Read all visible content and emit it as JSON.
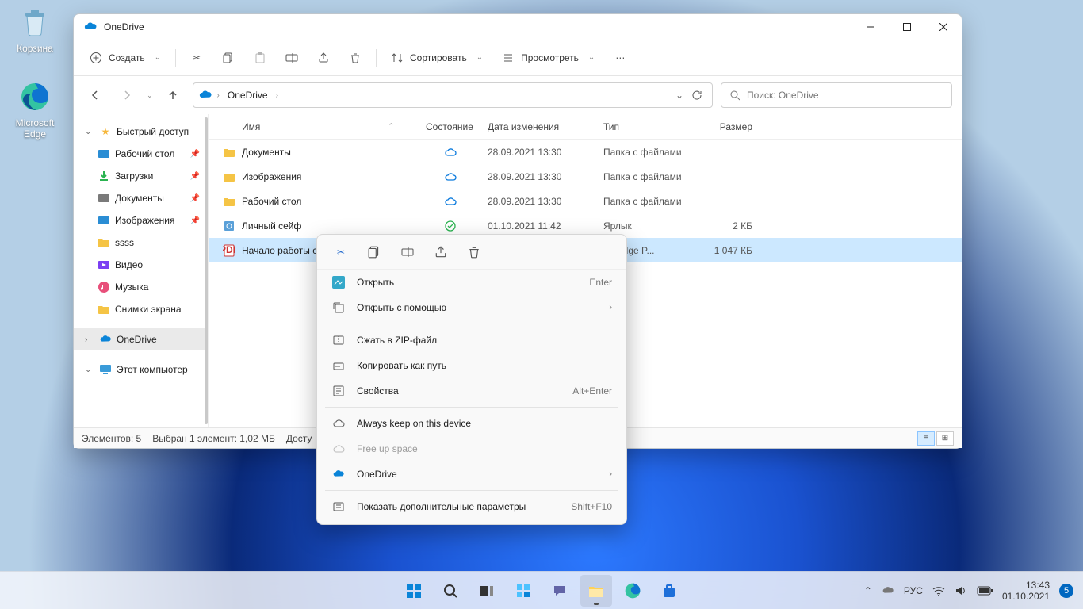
{
  "desktop": {
    "recycle": "Корзина",
    "edge": "Microsoft Edge"
  },
  "window": {
    "title": "OneDrive",
    "toolbar": {
      "create": "Создать",
      "sort": "Сортировать",
      "view": "Просмотреть"
    },
    "breadcrumb": "OneDrive",
    "search_placeholder": "Поиск: OneDrive",
    "columns": {
      "name": "Имя",
      "state": "Состояние",
      "date": "Дата изменения",
      "type": "Тип",
      "size": "Размер"
    },
    "rows": [
      {
        "name": "Документы",
        "date": "28.09.2021 13:30",
        "type": "Папка с файлами",
        "size": "",
        "icon": "folder",
        "state": "cloud"
      },
      {
        "name": "Изображения",
        "date": "28.09.2021 13:30",
        "type": "Папка с файлами",
        "size": "",
        "icon": "folder",
        "state": "cloud"
      },
      {
        "name": "Рабочий стол",
        "date": "28.09.2021 13:30",
        "type": "Папка с файлами",
        "size": "",
        "icon": "folder",
        "state": "cloud"
      },
      {
        "name": "Личный сейф",
        "date": "01.10.2021 11:42",
        "type": "Ярлык",
        "size": "2 КБ",
        "icon": "vault",
        "state": "synced"
      },
      {
        "name": "Начало работы с O",
        "date": "",
        "type": "oft Edge P...",
        "size": "1 047 КБ",
        "icon": "pdf",
        "state": "cloud",
        "selected": true
      }
    ],
    "status": {
      "count": "Элементов: 5",
      "selected": "Выбран 1 элемент: 1,02 МБ",
      "avail": "Досту"
    }
  },
  "sidebar": {
    "quick": "Быстрый доступ",
    "items": [
      {
        "label": "Рабочий стол",
        "pin": true,
        "color": "#2a8dd4",
        "glyph": "desktop"
      },
      {
        "label": "Загрузки",
        "pin": true,
        "color": "#2bb351",
        "glyph": "download"
      },
      {
        "label": "Документы",
        "pin": true,
        "color": "#7a7a7a",
        "glyph": "doc"
      },
      {
        "label": "Изображения",
        "pin": true,
        "color": "#2a8dd4",
        "glyph": "pic"
      },
      {
        "label": "ssss",
        "pin": false,
        "color": "#f5c445",
        "glyph": "folder"
      },
      {
        "label": "Видео",
        "pin": false,
        "color": "#7b3ff2",
        "glyph": "video"
      },
      {
        "label": "Музыка",
        "pin": false,
        "color": "#e84f7a",
        "glyph": "music"
      },
      {
        "label": "Снимки экрана",
        "pin": false,
        "color": "#f5c445",
        "glyph": "folder"
      }
    ],
    "onedrive": "OneDrive",
    "thispc": "Этот компьютер"
  },
  "context": {
    "open": "Открыть",
    "open_key": "Enter",
    "openwith": "Открыть с помощью",
    "zip": "Сжать в ZIP-файл",
    "copypath": "Копировать как путь",
    "props": "Свойства",
    "props_key": "Alt+Enter",
    "keep": "Always keep on this device",
    "free": "Free up space",
    "onedrive": "OneDrive",
    "more": "Показать дополнительные параметры",
    "more_key": "Shift+F10"
  },
  "taskbar": {
    "lang": "РУС",
    "time": "13:43",
    "date": "01.10.2021",
    "badge": "5"
  }
}
